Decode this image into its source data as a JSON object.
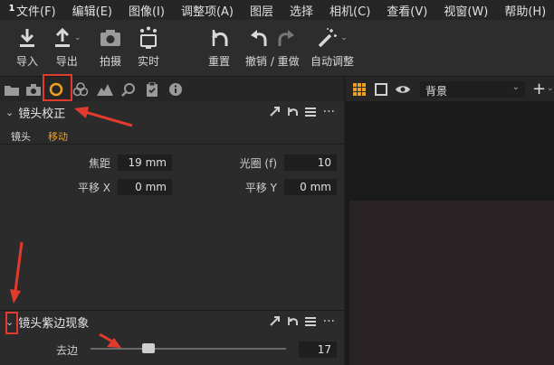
{
  "menu": [
    "文件(F)",
    "编辑(E)",
    "图像(I)",
    "调整项(A)",
    "图层",
    "选择",
    "相机(C)",
    "查看(V)",
    "视窗(W)",
    "帮助(H)"
  ],
  "app_logo": "1",
  "toolbar": {
    "import": "导入",
    "export": "导出",
    "capture": "拍摄",
    "live": "实时",
    "reset": "重置",
    "undo_redo": "撤销 / 重做",
    "auto_adjust": "自动调整"
  },
  "viewer": {
    "layer_select": "背景"
  },
  "lens_correction": {
    "title": "镜头校正",
    "tabs": [
      "镜头",
      "移动"
    ],
    "active_tab": 1,
    "focal_label": "焦距",
    "focal_value": "19 mm",
    "aperture_label": "光圈 (f)",
    "aperture_value": "10",
    "shift_x_label": "平移 X",
    "shift_x_value": "0 mm",
    "shift_y_label": "平移 Y",
    "shift_y_value": "0 mm"
  },
  "purple_fringing": {
    "title": "镜头紫边现象",
    "defringe_label": "去边",
    "defringe_value": "17",
    "defringe_fraction": 0.17
  },
  "colors": {
    "accent": "#f0a020",
    "annotation_red": "#e23b2e"
  },
  "icons": [
    "app-logo",
    "import-icon",
    "export-icon",
    "camera-icon",
    "live-icon",
    "reset-icon",
    "undo-icon",
    "redo-icon",
    "magic-wand-icon",
    "folder-icon",
    "capture-tab-icon",
    "lens-tab-icon",
    "color-tab-icon",
    "exposure-tab-icon",
    "details-tab-icon",
    "metadata-tab-icon",
    "info-tab-icon",
    "grid-icon",
    "single-view-icon",
    "eye-icon",
    "add-icon"
  ]
}
